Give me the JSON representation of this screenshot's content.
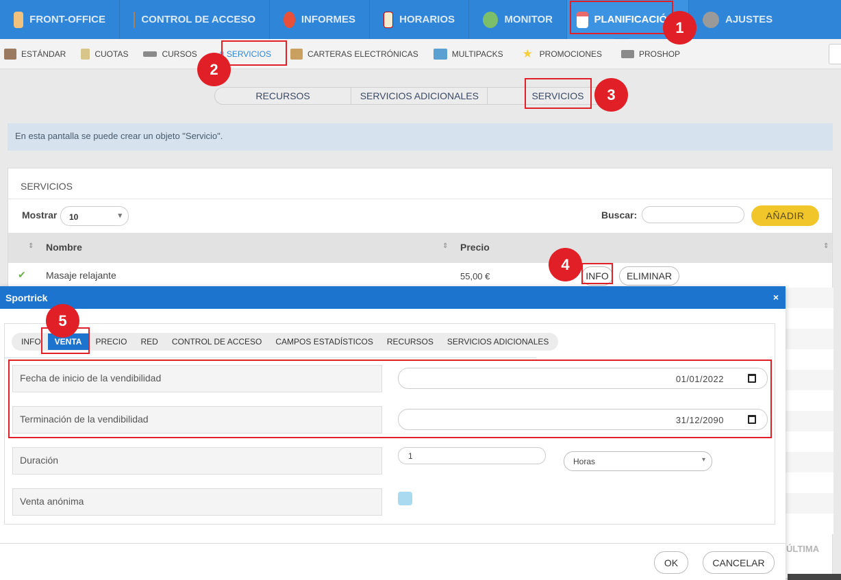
{
  "topnav": {
    "items": [
      {
        "label": "FRONT-OFFICE",
        "icon": "user-icon",
        "color": "#f1c27d"
      },
      {
        "label": "CONTROL DE ACCESO",
        "icon": "access-control-icon",
        "color": "#b08055"
      },
      {
        "label": "INFORMES",
        "icon": "pie-chart-icon",
        "color": "#e8503a"
      },
      {
        "label": "HORARIOS",
        "icon": "calendar-grid-icon",
        "color": "#f4ead0"
      },
      {
        "label": "MONITOR",
        "icon": "people-icon",
        "color": "#7cbf6a"
      },
      {
        "label": "PLANIFICACIÓN",
        "icon": "calendar-icon",
        "color": "#e86a6a"
      },
      {
        "label": "AJUSTES",
        "icon": "gear-icon",
        "color": "#9a9a9a"
      }
    ],
    "active_index": 5
  },
  "subnav": {
    "items": [
      {
        "label": "ESTÁNDAR",
        "icon": "box-icon",
        "color": "#9a7a60"
      },
      {
        "label": "CUOTAS",
        "icon": "clipboard-icon",
        "color": "#d8c58a"
      },
      {
        "label": "CURSOS",
        "icon": "books-icon",
        "color": "#8a8a8a"
      },
      {
        "label": "SERVICIOS",
        "icon": "services-icon",
        "color": "#9fc4e8"
      },
      {
        "label": "CARTERAS ELECTRÓNICAS",
        "icon": "wallet-icon",
        "color": "#c9a060"
      },
      {
        "label": "MULTIPACKS",
        "icon": "multipack-icon",
        "color": "#5aa0d0"
      },
      {
        "label": "PROMOCIONES",
        "icon": "star-icon",
        "color": "#f3cf3a"
      },
      {
        "label": "PROSHOP",
        "icon": "cash-register-icon",
        "color": "#8a8a8a"
      }
    ],
    "active_index": 3
  },
  "segtabs": [
    "RECURSOS",
    "SERVICIOS ADICIONALES",
    "SERVICIOS"
  ],
  "info_text": "En esta pantalla se puede crear un objeto \"Servicio\".",
  "panel": {
    "title": "SERVICIOS",
    "show_label": "Mostrar",
    "show_value": "10",
    "search_label": "Buscar:",
    "add_label": "AÑADIR",
    "columns": [
      "Nombre",
      "Precio"
    ],
    "rows": [
      {
        "name": "Masaje relajante",
        "price": "55,00 €",
        "info": "INFO",
        "delete": "ELIMINAR"
      }
    ],
    "last_label": "ÚLTIMA"
  },
  "modal": {
    "title": "Sportrick",
    "close": "×",
    "tabs": [
      "INFO",
      "VENTA",
      "PRECIO",
      "RED",
      "CONTROL DE ACCESO",
      "CAMPOS ESTADÍSTICOS",
      "RECURSOS",
      "SERVICIOS ADICIONALES"
    ],
    "active_tab": 1,
    "fields": {
      "start_label": "Fecha de inicio de la vendibilidad",
      "start_value": "01/01/2022",
      "end_label": "Terminación de la vendibilidad",
      "end_value": "31/12/2090",
      "duration_label": "Duración",
      "duration_value": "1",
      "duration_unit": "Horas",
      "anon_label": "Venta anónima"
    },
    "ok": "OK",
    "cancel": "CANCELAR"
  },
  "badges": [
    "1",
    "2",
    "3",
    "4",
    "5"
  ],
  "accent": "#2f86d8",
  "annotation_color": "#e01f26"
}
